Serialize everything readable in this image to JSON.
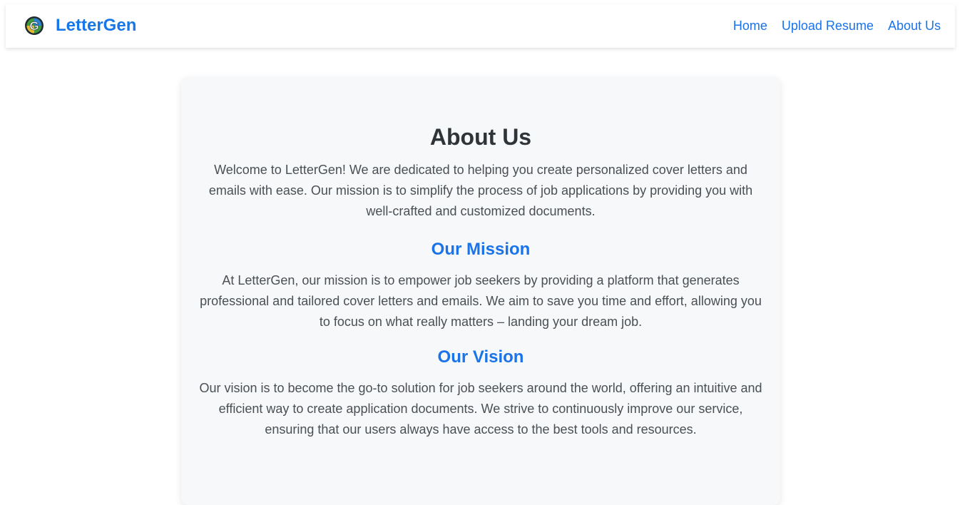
{
  "header": {
    "brand_name": "LetterGen",
    "logo_icon": "lettergen-g-logo-icon",
    "nav": [
      {
        "label": "Home"
      },
      {
        "label": "Upload Resume"
      },
      {
        "label": "About Us"
      }
    ]
  },
  "main": {
    "title": "About Us",
    "intro": "Welcome to LetterGen! We are dedicated to helping you create personalized cover letters and emails with ease. Our mission is to simplify the process of job applications by providing you with well-crafted and customized documents.",
    "mission": {
      "heading": "Our Mission",
      "text": "At LetterGen, our mission is to empower job seekers by providing a platform that generates professional and tailored cover letters and emails. We aim to save you time and effort, allowing you to focus on what really matters – landing your dream job."
    },
    "vision": {
      "heading": "Our Vision",
      "text": "Our vision is to become the go-to solution for job seekers around the world, offering an intuitive and efficient way to create application documents. We strive to continuously improve our service, ensuring that our users always have access to the best tools and resources."
    }
  },
  "colors": {
    "accent": "#1a73e8",
    "heading_text": "#2f3438",
    "body_text": "#4a4f54",
    "card_background": "#f7f8fa"
  }
}
